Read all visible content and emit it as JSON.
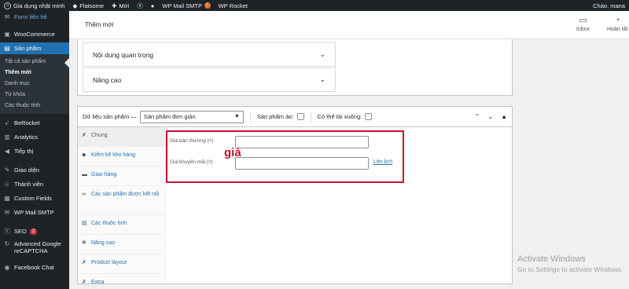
{
  "admin_bar": {
    "site_name": "Gia dụng nhật minh",
    "theme": "Flatsome",
    "new_label": "Mới",
    "wp_mail_smtp": "WP Mail SMTP",
    "wp_mail_smtp_badge": "!",
    "wp_rocket": "WP Rocket",
    "greeting": "Chào, mana"
  },
  "sidebar": {
    "top_link": "Form liên hệ",
    "woocommerce": "WooCommerce",
    "products": "Sản phẩm",
    "products_sub": [
      "Tất cả sản phẩm",
      "Thêm mới",
      "Danh mục",
      "Từ khóa",
      "Các thuộc tính"
    ],
    "items": [
      {
        "label": "BeRocket",
        "icon": "rocket-icon"
      },
      {
        "label": "Analytics",
        "icon": "analytics-icon"
      },
      {
        "label": "Tiếp thị",
        "icon": "megaphone-icon"
      },
      {
        "label": "Giao diện",
        "icon": "paintbrush-icon"
      },
      {
        "label": "Thành viên",
        "icon": "users-icon"
      },
      {
        "label": "Custom Fields",
        "icon": "fields-icon"
      },
      {
        "label": "WP Mail SMTP",
        "icon": "mail-icon"
      },
      {
        "label": "SEO",
        "icon": "seo-icon",
        "badge": "2"
      },
      {
        "label": "Advanced Google reCAPTCHA",
        "icon": "captcha-icon"
      },
      {
        "label": "Facebook Chat",
        "icon": "chat-icon"
      }
    ]
  },
  "header": {
    "title": "Thêm mới",
    "inbox": "Inbox",
    "finish": "Hoàn tất"
  },
  "accordion": [
    {
      "label": "Nội dung quan trọng"
    },
    {
      "label": "Nâng cao"
    }
  ],
  "product_data": {
    "label": "Dữ liệu sản phẩm —",
    "type_selected": "Sản phẩm đơn giản",
    "virtual_label": "Sản phẩm ảo:",
    "downloadable_label": "Có thể tải xuống:",
    "tabs": [
      {
        "label": "Chung",
        "icon": "wrench-icon"
      },
      {
        "label": "Kiểm kê kho hàng",
        "icon": "inventory-icon"
      },
      {
        "label": "Giao hàng",
        "icon": "truck-icon"
      },
      {
        "label": "Các sản phẩm được kết nối",
        "icon": "link-icon"
      },
      {
        "label": "Các thuộc tính",
        "icon": "list-icon"
      },
      {
        "label": "Nâng cao",
        "icon": "gear-icon"
      },
      {
        "label": "Product layout",
        "icon": "wrench-icon"
      },
      {
        "label": "Extra",
        "icon": "wrench-icon"
      }
    ],
    "regular_price_label": "Giá bán thường (₫)",
    "regular_price_value": "",
    "sale_price_label": "Giá khuyến mãi (₫)",
    "sale_price_value": "",
    "schedule_link": "Lên lịch"
  },
  "annotation": {
    "text": "giá",
    "color": "#c8102e"
  },
  "watermark": {
    "line1": "Activate Windows",
    "line2": "Go to Settings to activate Windows."
  },
  "colors": {
    "admin_dark": "#1d2327",
    "wp_blue": "#2271b1",
    "link_blue": "#72aee6",
    "badge_red": "#d63638"
  }
}
